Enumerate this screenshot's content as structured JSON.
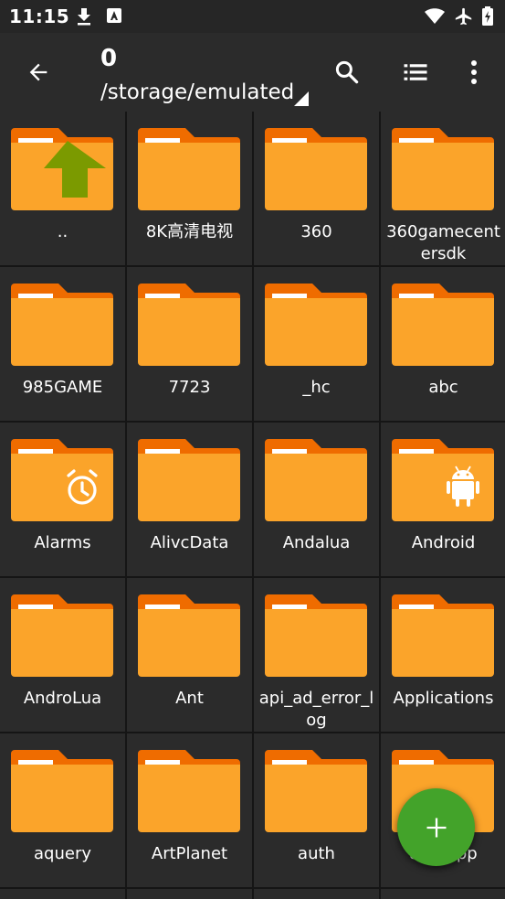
{
  "status_bar": {
    "time": "11:15"
  },
  "app_bar": {
    "title": "0",
    "path": "/storage/emulated"
  },
  "files": [
    {
      "name": "..",
      "overlay": "up-arrow"
    },
    {
      "name": "8K高清电视",
      "overlay": ""
    },
    {
      "name": "360",
      "overlay": ""
    },
    {
      "name": "360gamecentersdk",
      "overlay": ""
    },
    {
      "name": "985GAME",
      "overlay": ""
    },
    {
      "name": "7723",
      "overlay": ""
    },
    {
      "name": "_hc",
      "overlay": ""
    },
    {
      "name": "abc",
      "overlay": ""
    },
    {
      "name": "Alarms",
      "overlay": "alarm-clock"
    },
    {
      "name": "AlivcData",
      "overlay": ""
    },
    {
      "name": "Andalua",
      "overlay": ""
    },
    {
      "name": "Android",
      "overlay": "android-robot"
    },
    {
      "name": "AndroLua",
      "overlay": ""
    },
    {
      "name": "Ant",
      "overlay": ""
    },
    {
      "name": "api_ad_error_log",
      "overlay": ""
    },
    {
      "name": "Applications",
      "overlay": ""
    },
    {
      "name": "aquery",
      "overlay": ""
    },
    {
      "name": "ArtPlanet",
      "overlay": ""
    },
    {
      "name": "auth",
      "overlay": ""
    },
    {
      "name": "autoapp",
      "overlay": ""
    }
  ],
  "colors": {
    "folder_body": "#fba42a",
    "folder_tab": "#ef6c00",
    "fab": "#43a32a",
    "up_arrow": "#7b9a00"
  }
}
